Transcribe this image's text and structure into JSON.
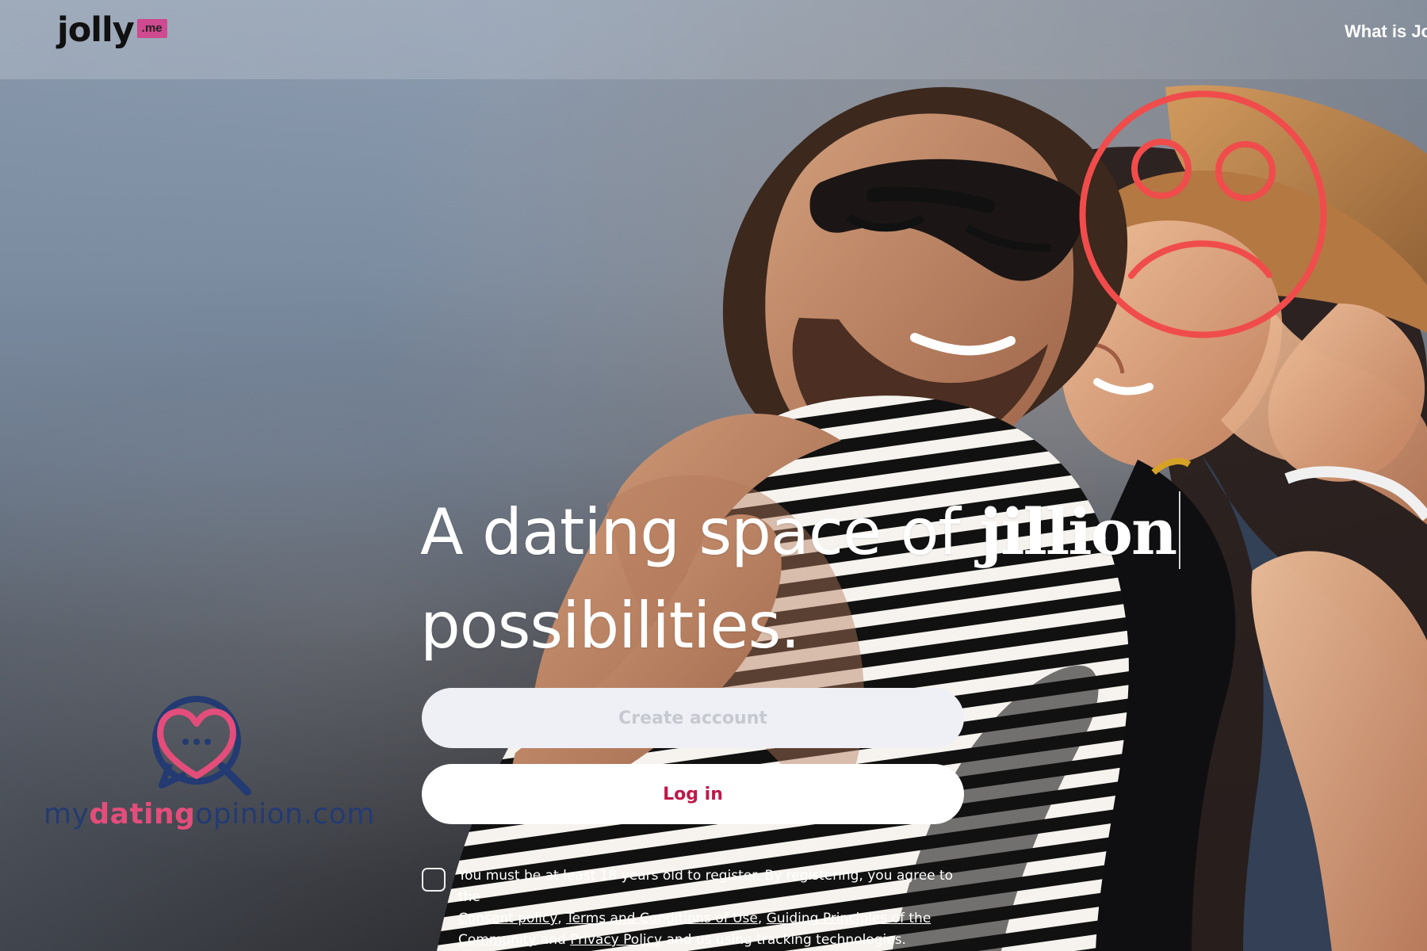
{
  "topbar": {
    "logo_word": "jolly",
    "logo_badge": ".me",
    "nav_link": "What is Jo"
  },
  "hero": {
    "headline_line1_prefix": "A dating space of",
    "headline_highlight": "jillion",
    "headline_line2": "possibilities."
  },
  "actions": {
    "create_account": "Create account",
    "log_in": "Log in"
  },
  "terms": {
    "text_1": "You must be at least 18 years old to register. By registering, you agree to the",
    "link_1": "Consent policy",
    "sep_1": ", ",
    "link_2": "Terms and Conditions of Use",
    "sep_2": ", ",
    "link_3": "Guiding Principles of the Community",
    "text_2": " and ",
    "link_4": "Privacy Policy",
    "text_3": " and us using tracking technologies."
  },
  "watermark": {
    "part_1": "my",
    "part_2": "dating",
    "part_3": "opinion",
    "part_4": ".com"
  },
  "icons": {
    "sad_face": "sad-face-icon",
    "heart_chat": "heart-chat-icon"
  },
  "colors": {
    "accent_pink": "#cf4a90",
    "login_red": "#be1849",
    "sad_face_red": "#f04c4c",
    "brand_navy": "#233a72"
  }
}
